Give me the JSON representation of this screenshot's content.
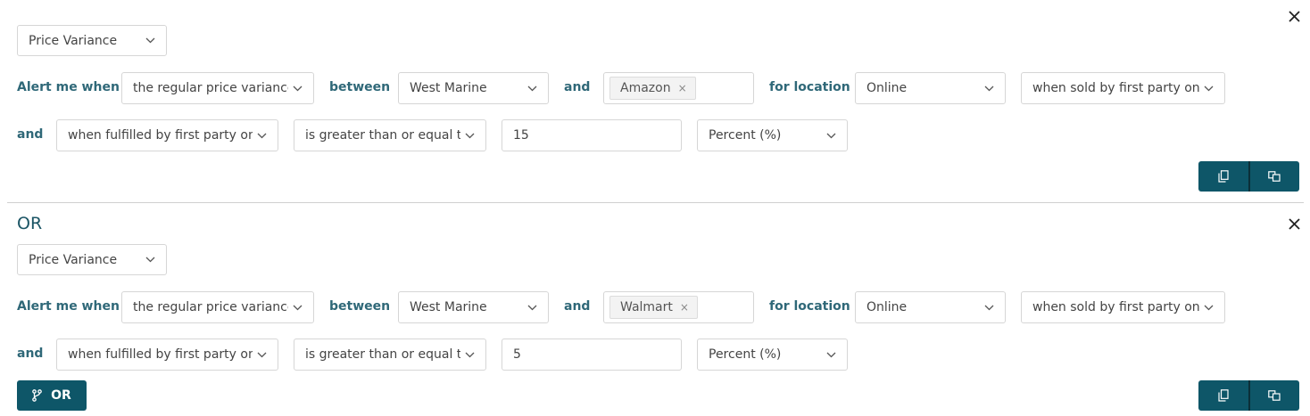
{
  "labels": {
    "alert_me_when": "Alert me when",
    "between": "between",
    "and": "and",
    "for_location": "for location",
    "or": "OR"
  },
  "rules": [
    {
      "metric": "Price Variance",
      "variance_type": "the regular price variance",
      "retailer": "West Marine",
      "competitor_tag": "Amazon",
      "location": "Online",
      "seller_filter": "when sold by first party only",
      "fulfillment_filter": "when fulfilled by first party only",
      "operator": "is greater than or equal to",
      "threshold": "15",
      "unit": "Percent (%)"
    },
    {
      "metric": "Price Variance",
      "variance_type": "the regular price variance",
      "retailer": "West Marine",
      "competitor_tag": "Walmart",
      "location": "Online",
      "seller_filter": "when sold by first party only",
      "fulfillment_filter": "when fulfilled by first party only",
      "operator": "is greater than or equal to",
      "threshold": "5",
      "unit": "Percent (%)"
    }
  ],
  "add_or_button": {
    "label": "OR",
    "icon": "branch-icon"
  },
  "icons": {
    "close": "close-icon",
    "chevron": "chevron-down-icon",
    "copy": "copy-icon",
    "duplicate": "duplicate-icon",
    "chip_remove": "×"
  },
  "colors": {
    "accent": "#0e5668",
    "label": "#2f6878",
    "heading": "#1b5565"
  }
}
